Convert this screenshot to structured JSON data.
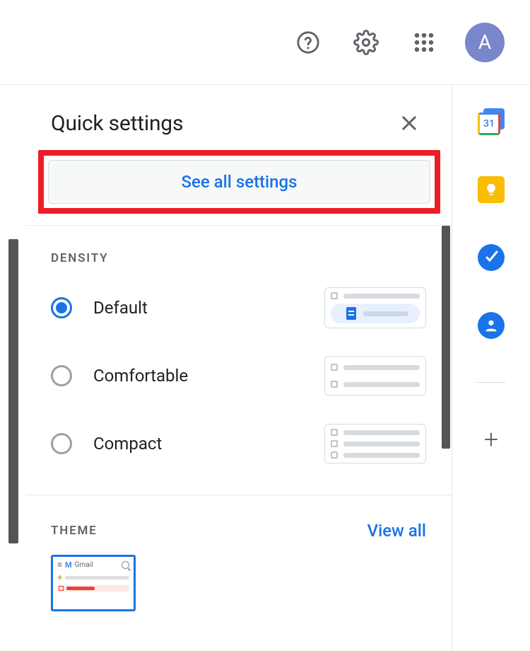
{
  "header": {
    "avatar_letter": "A"
  },
  "panel": {
    "title": "Quick settings",
    "see_all_label": "See all settings"
  },
  "density": {
    "title": "DENSITY",
    "options": [
      "Default",
      "Comfortable",
      "Compact"
    ],
    "selected_index": 0
  },
  "theme": {
    "title": "THEME",
    "view_all_label": "View all",
    "thumb_label": "Gmail"
  },
  "rail": {
    "calendar_day": "31"
  }
}
